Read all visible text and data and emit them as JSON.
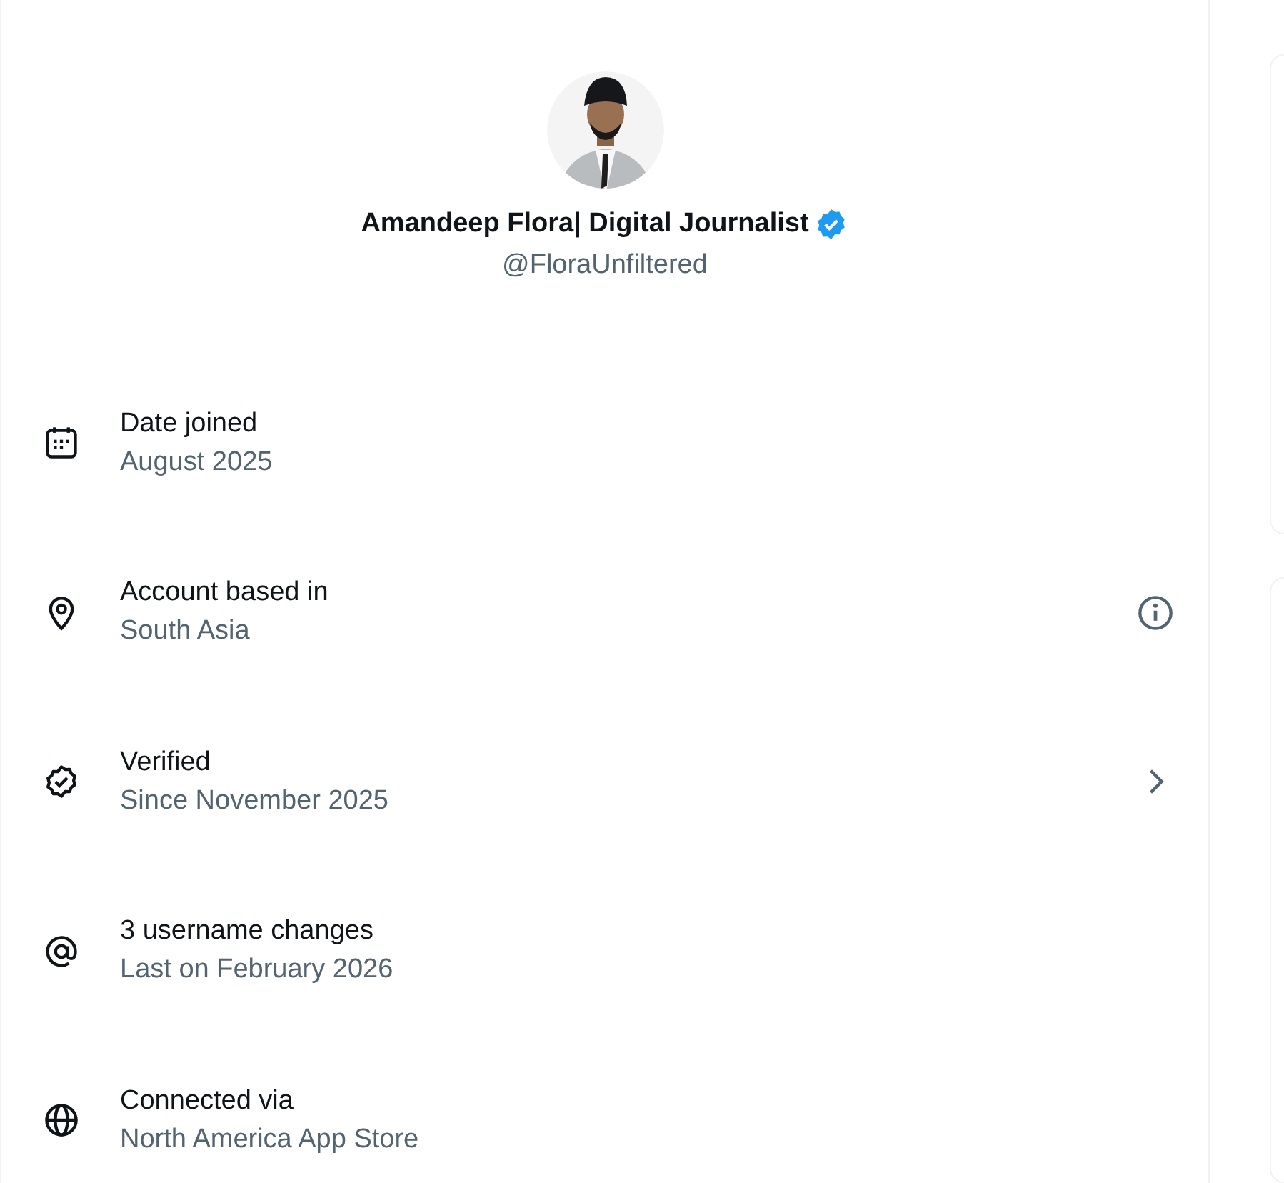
{
  "profile": {
    "name": "Amandeep Flora| Digital Journalist",
    "verified": true,
    "handle": "@FloraUnfiltered"
  },
  "details": [
    {
      "label": "Date joined",
      "value": "August 2025",
      "kind": "plain"
    },
    {
      "label": "Account based in",
      "value": "South Asia",
      "kind": "info"
    },
    {
      "label": "Verified",
      "value": "Since November 2025",
      "kind": "link"
    },
    {
      "label": "3 username changes",
      "value": "Last on February 2026",
      "kind": "plain"
    },
    {
      "label": "Connected via",
      "value": "North America App Store",
      "kind": "plain"
    }
  ]
}
